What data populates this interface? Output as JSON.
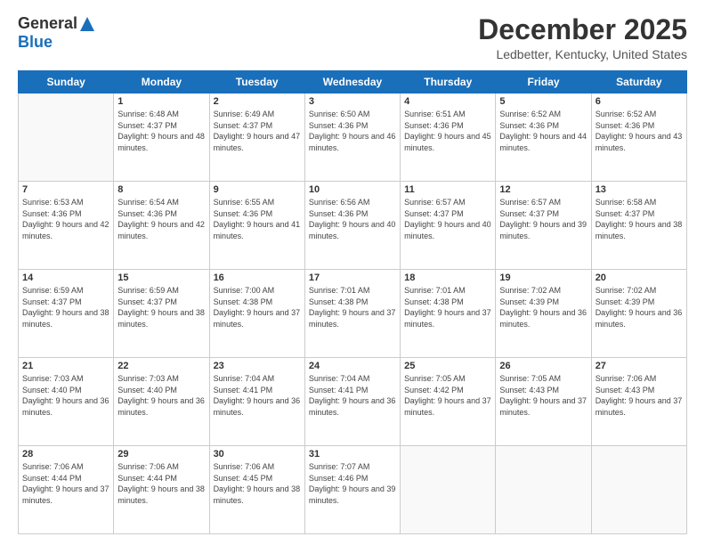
{
  "logo": {
    "general": "General",
    "blue": "Blue"
  },
  "title": "December 2025",
  "subtitle": "Ledbetter, Kentucky, United States",
  "days_of_week": [
    "Sunday",
    "Monday",
    "Tuesday",
    "Wednesday",
    "Thursday",
    "Friday",
    "Saturday"
  ],
  "weeks": [
    [
      {
        "day": "",
        "sunrise": "",
        "sunset": "",
        "daylight": ""
      },
      {
        "day": "1",
        "sunrise": "Sunrise: 6:48 AM",
        "sunset": "Sunset: 4:37 PM",
        "daylight": "Daylight: 9 hours and 48 minutes."
      },
      {
        "day": "2",
        "sunrise": "Sunrise: 6:49 AM",
        "sunset": "Sunset: 4:37 PM",
        "daylight": "Daylight: 9 hours and 47 minutes."
      },
      {
        "day": "3",
        "sunrise": "Sunrise: 6:50 AM",
        "sunset": "Sunset: 4:36 PM",
        "daylight": "Daylight: 9 hours and 46 minutes."
      },
      {
        "day": "4",
        "sunrise": "Sunrise: 6:51 AM",
        "sunset": "Sunset: 4:36 PM",
        "daylight": "Daylight: 9 hours and 45 minutes."
      },
      {
        "day": "5",
        "sunrise": "Sunrise: 6:52 AM",
        "sunset": "Sunset: 4:36 PM",
        "daylight": "Daylight: 9 hours and 44 minutes."
      },
      {
        "day": "6",
        "sunrise": "Sunrise: 6:52 AM",
        "sunset": "Sunset: 4:36 PM",
        "daylight": "Daylight: 9 hours and 43 minutes."
      }
    ],
    [
      {
        "day": "7",
        "sunrise": "Sunrise: 6:53 AM",
        "sunset": "Sunset: 4:36 PM",
        "daylight": "Daylight: 9 hours and 42 minutes."
      },
      {
        "day": "8",
        "sunrise": "Sunrise: 6:54 AM",
        "sunset": "Sunset: 4:36 PM",
        "daylight": "Daylight: 9 hours and 42 minutes."
      },
      {
        "day": "9",
        "sunrise": "Sunrise: 6:55 AM",
        "sunset": "Sunset: 4:36 PM",
        "daylight": "Daylight: 9 hours and 41 minutes."
      },
      {
        "day": "10",
        "sunrise": "Sunrise: 6:56 AM",
        "sunset": "Sunset: 4:36 PM",
        "daylight": "Daylight: 9 hours and 40 minutes."
      },
      {
        "day": "11",
        "sunrise": "Sunrise: 6:57 AM",
        "sunset": "Sunset: 4:37 PM",
        "daylight": "Daylight: 9 hours and 40 minutes."
      },
      {
        "day": "12",
        "sunrise": "Sunrise: 6:57 AM",
        "sunset": "Sunset: 4:37 PM",
        "daylight": "Daylight: 9 hours and 39 minutes."
      },
      {
        "day": "13",
        "sunrise": "Sunrise: 6:58 AM",
        "sunset": "Sunset: 4:37 PM",
        "daylight": "Daylight: 9 hours and 38 minutes."
      }
    ],
    [
      {
        "day": "14",
        "sunrise": "Sunrise: 6:59 AM",
        "sunset": "Sunset: 4:37 PM",
        "daylight": "Daylight: 9 hours and 38 minutes."
      },
      {
        "day": "15",
        "sunrise": "Sunrise: 6:59 AM",
        "sunset": "Sunset: 4:37 PM",
        "daylight": "Daylight: 9 hours and 38 minutes."
      },
      {
        "day": "16",
        "sunrise": "Sunrise: 7:00 AM",
        "sunset": "Sunset: 4:38 PM",
        "daylight": "Daylight: 9 hours and 37 minutes."
      },
      {
        "day": "17",
        "sunrise": "Sunrise: 7:01 AM",
        "sunset": "Sunset: 4:38 PM",
        "daylight": "Daylight: 9 hours and 37 minutes."
      },
      {
        "day": "18",
        "sunrise": "Sunrise: 7:01 AM",
        "sunset": "Sunset: 4:38 PM",
        "daylight": "Daylight: 9 hours and 37 minutes."
      },
      {
        "day": "19",
        "sunrise": "Sunrise: 7:02 AM",
        "sunset": "Sunset: 4:39 PM",
        "daylight": "Daylight: 9 hours and 36 minutes."
      },
      {
        "day": "20",
        "sunrise": "Sunrise: 7:02 AM",
        "sunset": "Sunset: 4:39 PM",
        "daylight": "Daylight: 9 hours and 36 minutes."
      }
    ],
    [
      {
        "day": "21",
        "sunrise": "Sunrise: 7:03 AM",
        "sunset": "Sunset: 4:40 PM",
        "daylight": "Daylight: 9 hours and 36 minutes."
      },
      {
        "day": "22",
        "sunrise": "Sunrise: 7:03 AM",
        "sunset": "Sunset: 4:40 PM",
        "daylight": "Daylight: 9 hours and 36 minutes."
      },
      {
        "day": "23",
        "sunrise": "Sunrise: 7:04 AM",
        "sunset": "Sunset: 4:41 PM",
        "daylight": "Daylight: 9 hours and 36 minutes."
      },
      {
        "day": "24",
        "sunrise": "Sunrise: 7:04 AM",
        "sunset": "Sunset: 4:41 PM",
        "daylight": "Daylight: 9 hours and 36 minutes."
      },
      {
        "day": "25",
        "sunrise": "Sunrise: 7:05 AM",
        "sunset": "Sunset: 4:42 PM",
        "daylight": "Daylight: 9 hours and 37 minutes."
      },
      {
        "day": "26",
        "sunrise": "Sunrise: 7:05 AM",
        "sunset": "Sunset: 4:43 PM",
        "daylight": "Daylight: 9 hours and 37 minutes."
      },
      {
        "day": "27",
        "sunrise": "Sunrise: 7:06 AM",
        "sunset": "Sunset: 4:43 PM",
        "daylight": "Daylight: 9 hours and 37 minutes."
      }
    ],
    [
      {
        "day": "28",
        "sunrise": "Sunrise: 7:06 AM",
        "sunset": "Sunset: 4:44 PM",
        "daylight": "Daylight: 9 hours and 37 minutes."
      },
      {
        "day": "29",
        "sunrise": "Sunrise: 7:06 AM",
        "sunset": "Sunset: 4:44 PM",
        "daylight": "Daylight: 9 hours and 38 minutes."
      },
      {
        "day": "30",
        "sunrise": "Sunrise: 7:06 AM",
        "sunset": "Sunset: 4:45 PM",
        "daylight": "Daylight: 9 hours and 38 minutes."
      },
      {
        "day": "31",
        "sunrise": "Sunrise: 7:07 AM",
        "sunset": "Sunset: 4:46 PM",
        "daylight": "Daylight: 9 hours and 39 minutes."
      },
      {
        "day": "",
        "sunrise": "",
        "sunset": "",
        "daylight": ""
      },
      {
        "day": "",
        "sunrise": "",
        "sunset": "",
        "daylight": ""
      },
      {
        "day": "",
        "sunrise": "",
        "sunset": "",
        "daylight": ""
      }
    ]
  ]
}
